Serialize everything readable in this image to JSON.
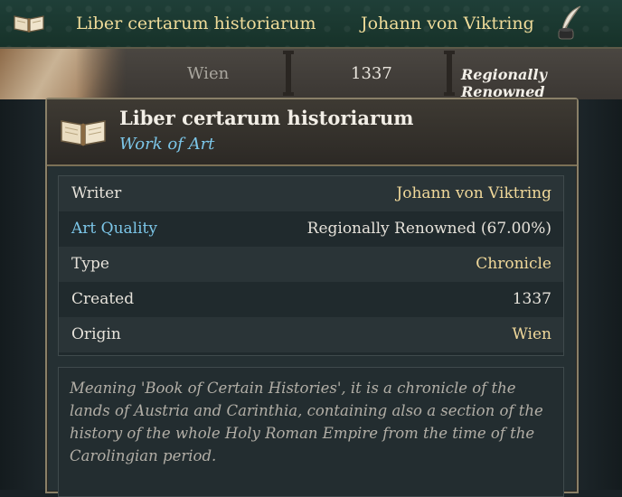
{
  "topbar": {
    "title": "Liber certarum historiarum",
    "author": "Johann von Viktring",
    "book_icon": "book-icon",
    "quill_icon": "quill-icon"
  },
  "subbar": {
    "city": "Wien",
    "year": "1337",
    "renown": "Regionally Renowned"
  },
  "panel": {
    "title": "Liber certarum historiarum",
    "subtitle": "Work of Art",
    "rows": [
      {
        "key": "Writer",
        "value": "Johann von Viktring"
      },
      {
        "key": "Art Quality",
        "value": "Regionally Renowned (67.00%)"
      },
      {
        "key": "Type",
        "value": "Chronicle"
      },
      {
        "key": "Created",
        "value": "1337"
      },
      {
        "key": "Origin",
        "value": "Wien"
      }
    ],
    "description": "Meaning 'Book of Certain Histories', it is a chronicle of the lands of Austria and Carinthia, containing also a section of the history of the whole Holy Roman Empire from the time of the Carolingian period."
  },
  "colors": {
    "gold": "#f0d89a",
    "blue": "#7cc6e8",
    "panel_bg": "#253033",
    "border": "#8a8068"
  }
}
